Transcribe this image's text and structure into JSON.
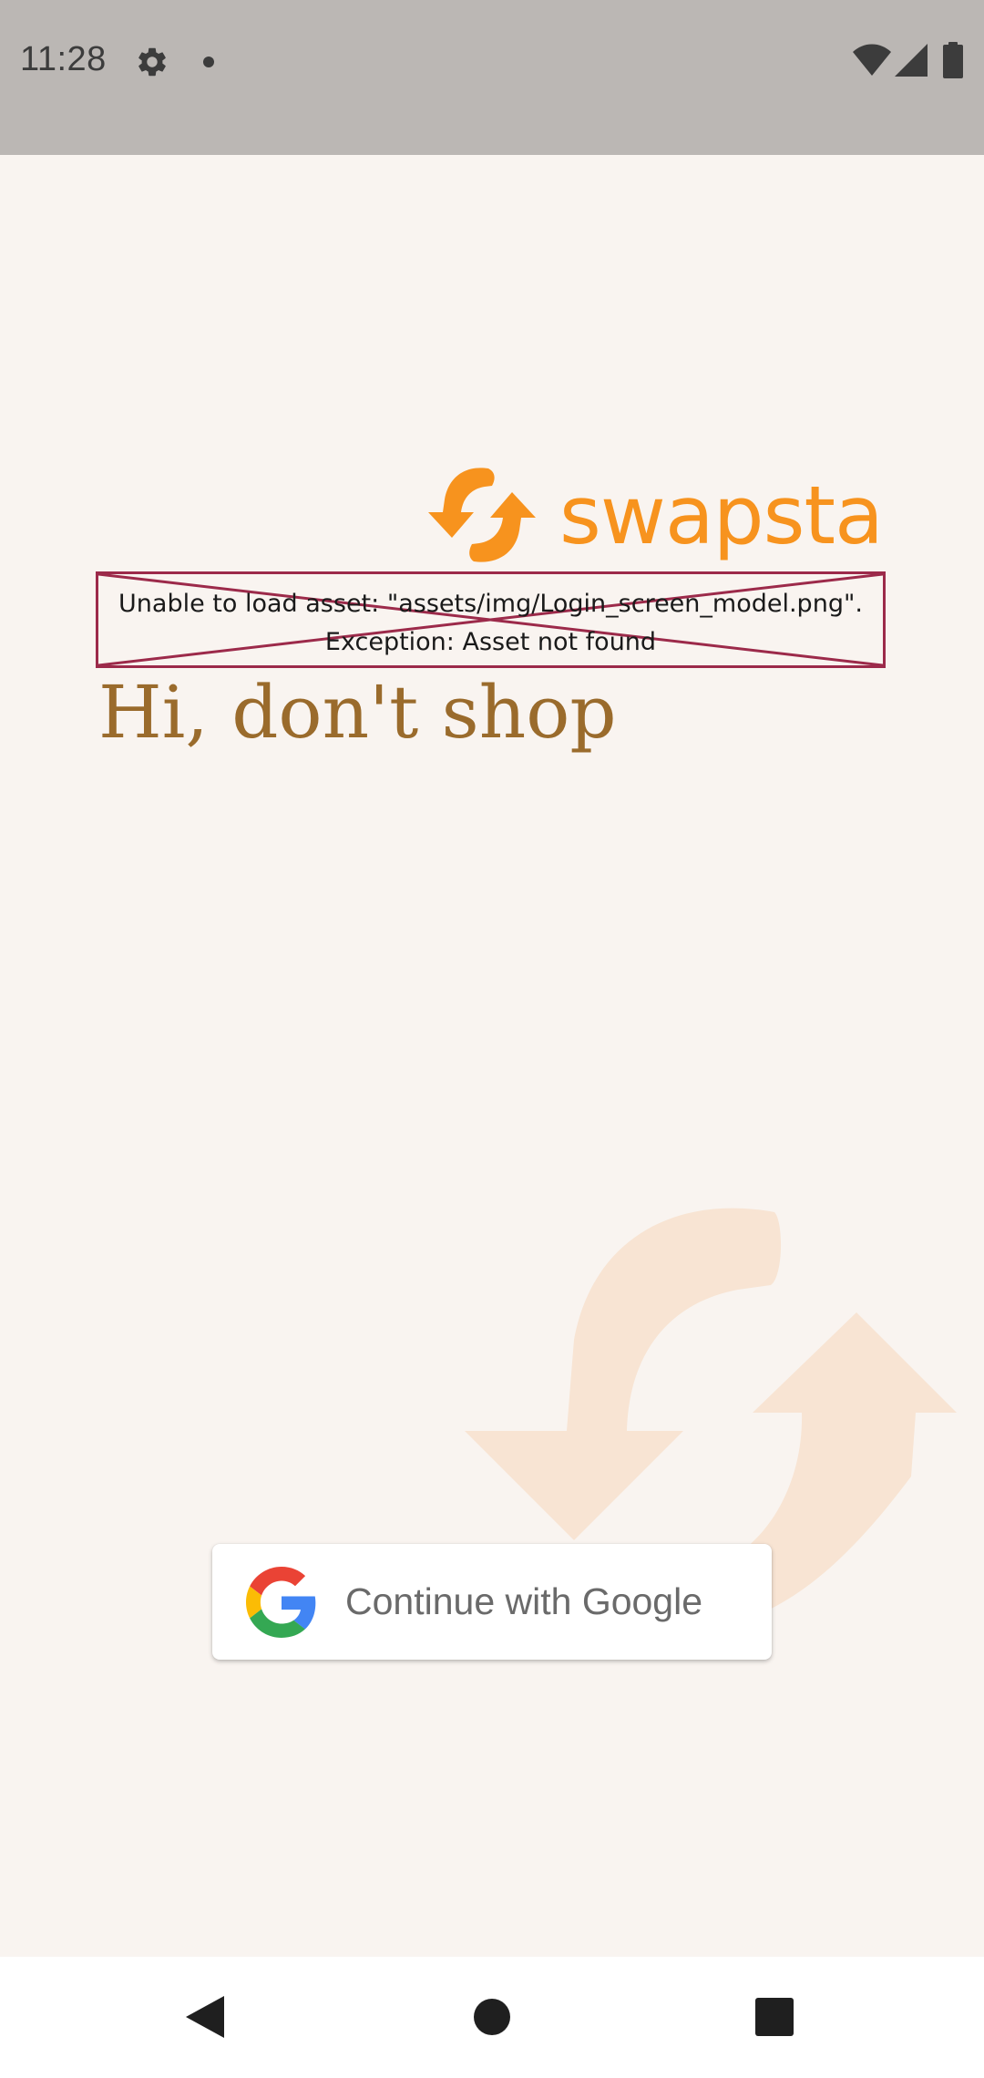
{
  "status_bar": {
    "time": "11:28",
    "icons": [
      "settings-icon",
      "notification-dot-icon",
      "wifi-icon",
      "cellular-signal-icon",
      "battery-icon"
    ]
  },
  "logo": {
    "text": "swapsta",
    "color": "#f7931e"
  },
  "asset_error": {
    "message": "Unable to load asset: \"assets/img/Login_screen_model.png\".\nException: Asset not found",
    "border_color": "#9c2a4a"
  },
  "greeting": {
    "text": "Hi, don't shop",
    "color": "#9a6b2c"
  },
  "google_button": {
    "label": "Continue with Google",
    "icon": "google-g-icon"
  },
  "nav_bar": {
    "icons": [
      "back-icon",
      "home-icon",
      "recents-icon"
    ]
  },
  "colors": {
    "background": "#f9f4f0",
    "status_bar": "#bbb7b4",
    "watermark": "#f8e4d3"
  }
}
